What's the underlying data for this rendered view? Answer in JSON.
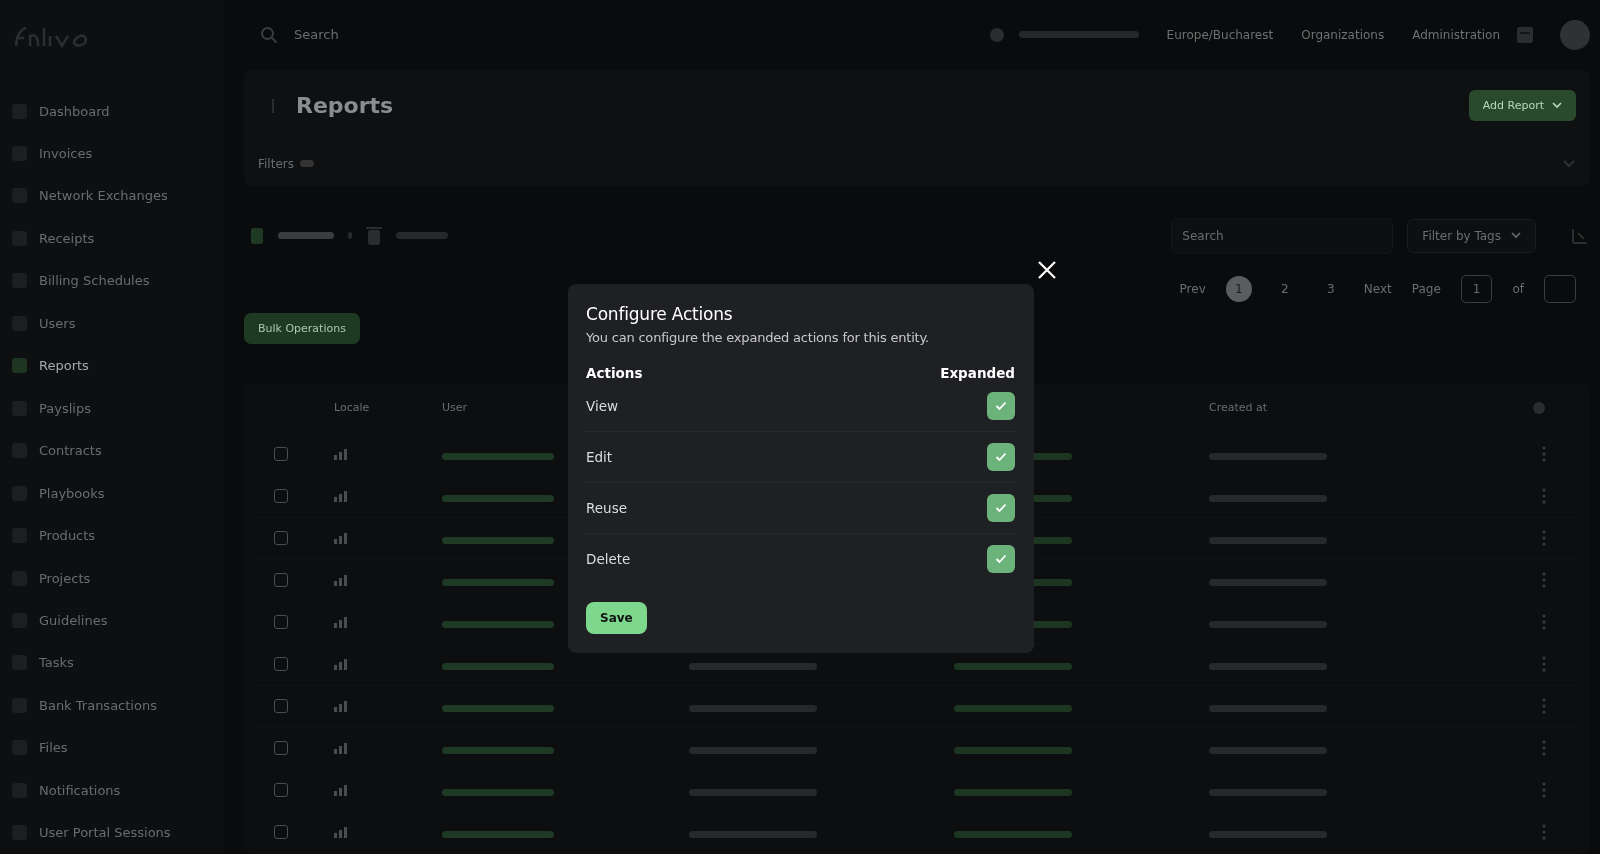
{
  "sidebar": {
    "items": [
      {
        "label": "Dashboard",
        "selected": false
      },
      {
        "label": "Invoices",
        "selected": false
      },
      {
        "label": "Network Exchanges",
        "selected": false
      },
      {
        "label": "Receipts",
        "selected": false
      },
      {
        "label": "Billing Schedules",
        "selected": false
      },
      {
        "label": "Users",
        "selected": false
      },
      {
        "label": "Reports",
        "selected": true
      },
      {
        "label": "Payslips",
        "selected": false
      },
      {
        "label": "Contracts",
        "selected": false
      },
      {
        "label": "Playbooks",
        "selected": false
      },
      {
        "label": "Products",
        "selected": false
      },
      {
        "label": "Projects",
        "selected": false
      },
      {
        "label": "Guidelines",
        "selected": false
      },
      {
        "label": "Tasks",
        "selected": false
      },
      {
        "label": "Bank Transactions",
        "selected": false
      },
      {
        "label": "Files",
        "selected": false
      },
      {
        "label": "Notifications",
        "selected": false
      },
      {
        "label": "User Portal Sessions",
        "selected": false
      }
    ]
  },
  "topbar": {
    "search_placeholder": "Search",
    "timezone": "Europe/Bucharest",
    "links": [
      "Organizations",
      "Administration"
    ]
  },
  "page": {
    "title": "Reports",
    "add_button": "Add Report",
    "filters_label": "Filters"
  },
  "toolbar": {
    "search_placeholder": "Search",
    "tag_filter": "Filter by Tags",
    "bulk_button": "Bulk Operations"
  },
  "pagination": {
    "prev": "Prev",
    "pages": [
      {
        "label": "1",
        "selected": true
      },
      {
        "label": "2",
        "selected": false
      },
      {
        "label": "3",
        "selected": false
      }
    ],
    "next": "Next",
    "page_label": "Page",
    "page_value": "1",
    "of": "of"
  },
  "table": {
    "columns": [
      "Locale",
      "User",
      "Created at"
    ],
    "rows": [
      {
        "checked": false
      },
      {
        "checked": false
      },
      {
        "checked": false
      },
      {
        "checked": false
      },
      {
        "checked": false
      },
      {
        "checked": false
      },
      {
        "checked": false
      },
      {
        "checked": false
      },
      {
        "checked": false
      },
      {
        "checked": false
      }
    ]
  },
  "modal": {
    "title": "Configure Actions",
    "description": "You can configure the expanded actions for this entity.",
    "col_actions": "Actions",
    "col_expanded": "Expanded",
    "actions": [
      {
        "label": "View",
        "expanded": true
      },
      {
        "label": "Edit",
        "expanded": true
      },
      {
        "label": "Reuse",
        "expanded": true
      },
      {
        "label": "Delete",
        "expanded": true
      }
    ],
    "save": "Save"
  }
}
